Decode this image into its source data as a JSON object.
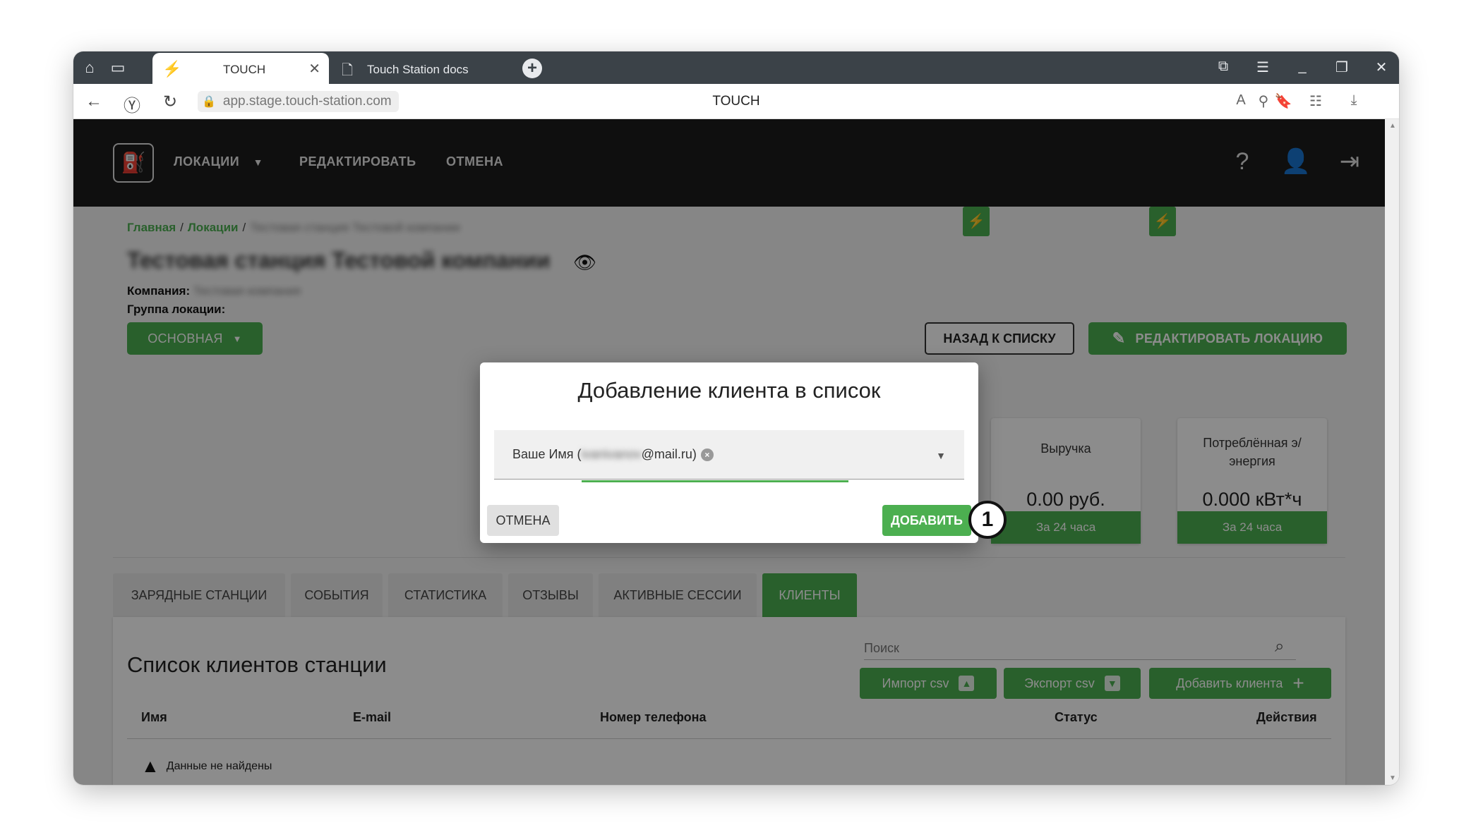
{
  "browser": {
    "tabs": [
      {
        "label": "TOUCH",
        "active": true
      },
      {
        "label": "Touch Station docs",
        "active": false
      }
    ],
    "url": "app.stage.touch-station.com",
    "page_title": "TOUCH",
    "accent": "#4caf50"
  },
  "appbar": {
    "nav": [
      {
        "label": "ЛОКАЦИИ"
      },
      {
        "label": "РЕДАКТИРОВАТЬ"
      },
      {
        "label": "ОТМЕНА"
      }
    ]
  },
  "breadcrumb": {
    "home": "Главная",
    "locations": "Локации",
    "current": "Тестовая станция Тестовой компании"
  },
  "station": {
    "title": "Тестовая станция Тестовой компании",
    "company_label": "Компания:",
    "company_value": "Тестовая компания",
    "group_label": "Группа локации:",
    "group_value": "ОСНОВНАЯ"
  },
  "actions": {
    "back": "НАЗАД К СПИСКУ",
    "edit": "РЕДАКТИРОВАТЬ ЛОКАЦИЮ"
  },
  "cards": [
    {
      "title": "Выручка",
      "value": "0.00 руб.",
      "footer": "За 24 часа"
    },
    {
      "title": "Потреблённая э/ энергия",
      "value": "0.000 кВт*ч",
      "footer": "За 24 часа"
    }
  ],
  "tabs": [
    {
      "label": "ЗАРЯДНЫЕ СТАНЦИИ"
    },
    {
      "label": "СОБЫТИЯ"
    },
    {
      "label": "СТАТИСТИКА"
    },
    {
      "label": "ОТЗЫВЫ"
    },
    {
      "label": "АКТИВНЫЕ СЕССИИ"
    },
    {
      "label": "КЛИЕНТЫ",
      "active": true
    }
  ],
  "clients": {
    "title": "Список клиентов станции",
    "search_placeholder": "Поиск",
    "import_label": "Импорт csv",
    "export_label": "Экспорт csv",
    "add_label": "Добавить клиента",
    "columns": [
      "Имя",
      "E-mail",
      "Номер телефона",
      "Статус",
      "Действия"
    ],
    "empty_text": "Данные не найдены"
  },
  "modal": {
    "title": "Добавление клиента в список",
    "chip_name": "Ваше Имя (",
    "chip_hidden": "ivanivanov",
    "chip_domain": "@mail.ru)",
    "cancel_label": "ОТМЕНА",
    "add_label": "ДОБАВИТЬ"
  },
  "callout": {
    "number": "1"
  }
}
